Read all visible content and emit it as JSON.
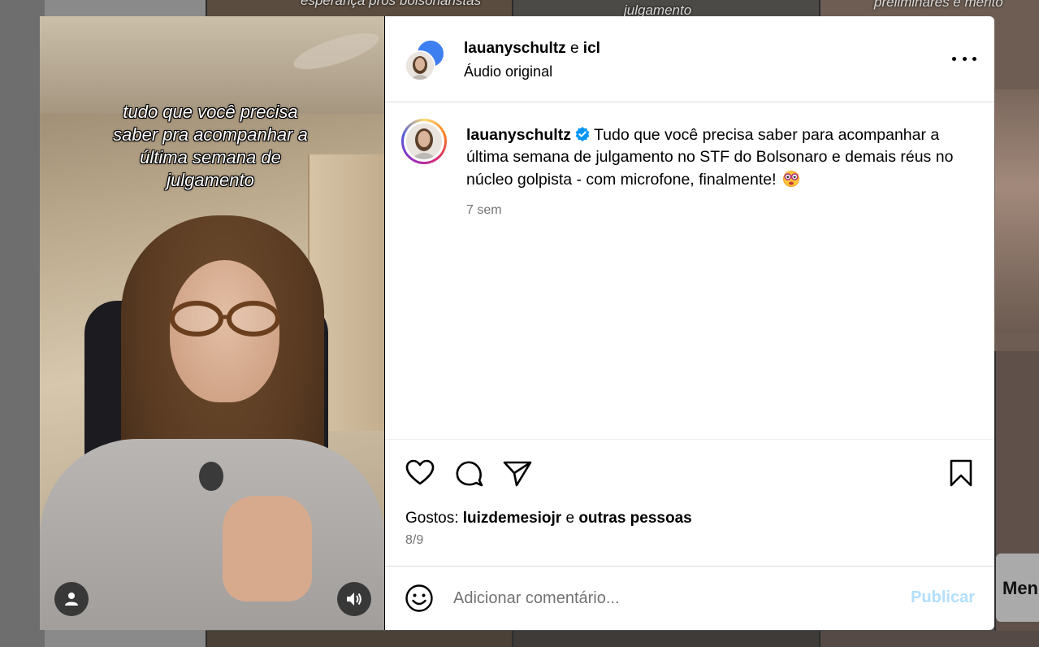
{
  "background": {
    "tile_texts": [
      "esperança pros bolsonaristas",
      "julgamento",
      "preliminares e mérito"
    ],
    "side_button": "Men"
  },
  "media": {
    "overlay_lines": [
      "tudo que você precisa",
      "saber pra acompanhar a",
      "última semana de",
      "julgamento"
    ],
    "user_icon": "user-icon",
    "audio_icon": "speaker-icon"
  },
  "header": {
    "user1": "lauanyschultz",
    "conjunction": "e",
    "user2": "icl",
    "audio": "Áudio original",
    "more_icon": "more-options-icon"
  },
  "caption": {
    "username": "lauanyschultz",
    "text": "Tudo que você precisa saber para acompanhar a última semana de julgamento no STF do Bolsonaro e demais réus no núcleo golpista - com microfone, finalmente!",
    "time": "7 sem"
  },
  "actions": {
    "likes_prefix": "Gostos:",
    "likes_user": "luizdemesiojr",
    "likes_conj": "e",
    "likes_rest": "outras pessoas",
    "date": "8/9"
  },
  "comment": {
    "placeholder": "Adicionar comentário...",
    "publish": "Publicar"
  },
  "colors": {
    "verified": "#0095f6",
    "publish_disabled": "#b2dffc",
    "secondary_text": "#737373"
  }
}
